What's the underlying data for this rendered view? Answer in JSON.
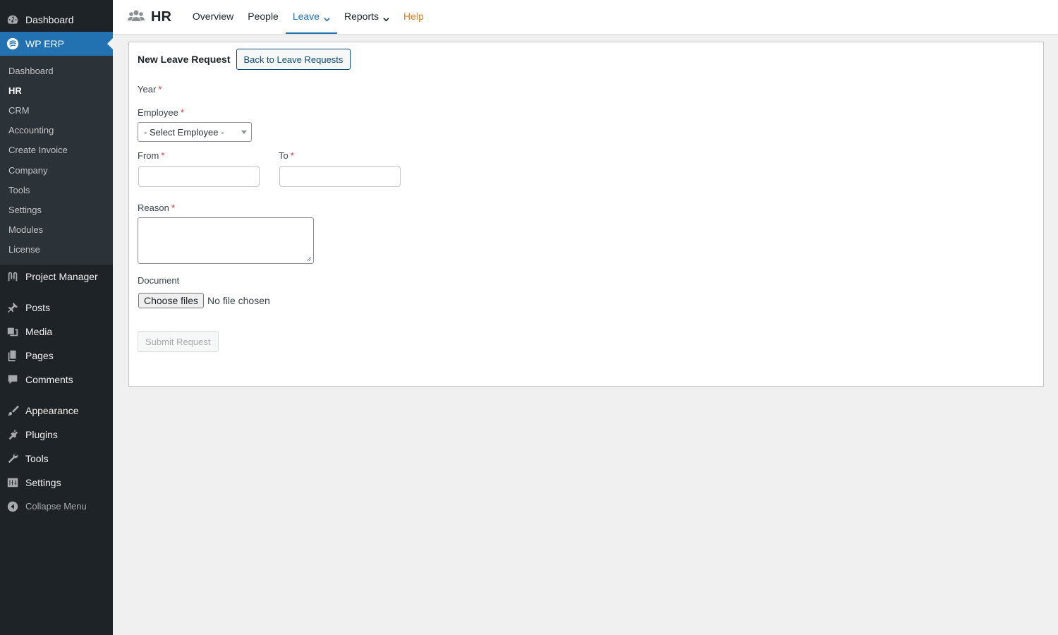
{
  "sidebar": {
    "dashboard": "Dashboard",
    "wp_erp": "WP ERP",
    "submenu": [
      "Dashboard",
      "HR",
      "CRM",
      "Accounting",
      "Create Invoice",
      "Company",
      "Tools",
      "Settings",
      "Modules",
      "License"
    ],
    "project_manager": "Project Manager",
    "posts": "Posts",
    "media": "Media",
    "pages": "Pages",
    "comments": "Comments",
    "appearance": "Appearance",
    "plugins": "Plugins",
    "tools": "Tools",
    "settings": "Settings",
    "collapse": "Collapse Menu"
  },
  "header": {
    "title": "HR",
    "nav": [
      "Overview",
      "People",
      "Leave",
      "Reports",
      "Help"
    ]
  },
  "form": {
    "title": "New Leave Request",
    "back_button": "Back to Leave Requests",
    "year_label": "Year",
    "employee_label": "Employee",
    "employee_selected": "- Select Employee -",
    "from_label": "From",
    "to_label": "To",
    "reason_label": "Reason",
    "document_label": "Document",
    "file_button": "Choose files",
    "file_status": "No file chosen",
    "submit": "Submit Request",
    "required_mark": "*"
  },
  "colors": {
    "sidebar_bg": "#1d2327",
    "accent": "#2271b1",
    "help": "#dd7e22",
    "required": "#d63638"
  }
}
